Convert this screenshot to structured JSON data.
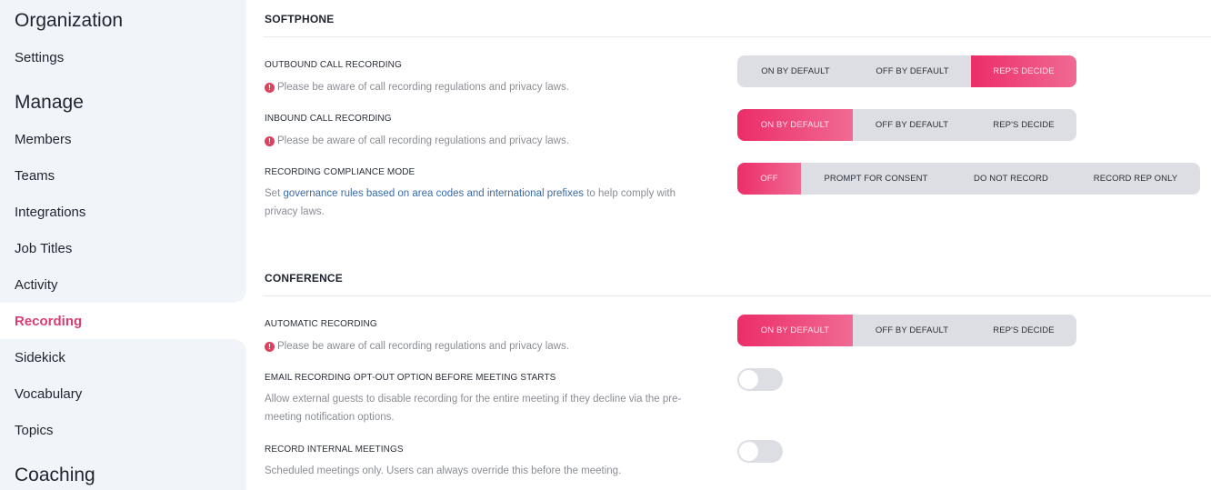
{
  "sidebar": {
    "groups": [
      {
        "heading": "Organization",
        "items": [
          "Settings"
        ]
      },
      {
        "heading": "Manage",
        "items": [
          "Members",
          "Teams",
          "Integrations",
          "Job Titles",
          "Activity",
          "Recording",
          "Sidekick",
          "Vocabulary",
          "Topics"
        ]
      },
      {
        "heading": "Coaching",
        "items": []
      }
    ],
    "active_item": "Recording"
  },
  "softphone": {
    "title": "SOFTPHONE",
    "outbound": {
      "label": "OUTBOUND CALL RECORDING",
      "warning": "Please be aware of call recording regulations and privacy laws.",
      "options": [
        "ON BY DEFAULT",
        "OFF BY DEFAULT",
        "REP'S DECIDE"
      ],
      "selected": "REP'S DECIDE"
    },
    "inbound": {
      "label": "INBOUND CALL RECORDING",
      "warning": "Please be aware of call recording regulations and privacy laws.",
      "options": [
        "ON BY DEFAULT",
        "OFF BY DEFAULT",
        "REP'S DECIDE"
      ],
      "selected": "ON BY DEFAULT"
    },
    "compliance": {
      "label": "RECORDING COMPLIANCE MODE",
      "desc_prefix": "Set ",
      "desc_link": "governance rules based on area codes and international prefixes",
      "desc_suffix": " to help comply with privacy laws.",
      "options": [
        "OFF",
        "PROMPT FOR CONSENT",
        "DO NOT RECORD",
        "RECORD REP ONLY"
      ],
      "selected": "OFF"
    }
  },
  "conference": {
    "title": "CONFERENCE",
    "automatic": {
      "label": "AUTOMATIC RECORDING",
      "warning": "Please be aware of call recording regulations and privacy laws.",
      "options": [
        "ON BY DEFAULT",
        "OFF BY DEFAULT",
        "REP'S DECIDE"
      ],
      "selected": "ON BY DEFAULT"
    },
    "email_opt_out": {
      "label": "EMAIL RECORDING OPT-OUT OPTION BEFORE MEETING STARTS",
      "desc": "Allow external guests to disable recording for the entire meeting if they decline via the pre-meeting notification options.",
      "enabled": false
    },
    "internal": {
      "label": "RECORD INTERNAL MEETINGS",
      "desc": "Scheduled meetings only. Users can always override this before the meeting.",
      "enabled": false
    }
  },
  "icons": {
    "warning": "exclamation-circle-icon",
    "warning_glyph": "!"
  },
  "colors": {
    "accent": "#ec2d68",
    "active_nav": "#d63f6f",
    "link": "#3b6aa6",
    "warning": "#e0405f"
  }
}
